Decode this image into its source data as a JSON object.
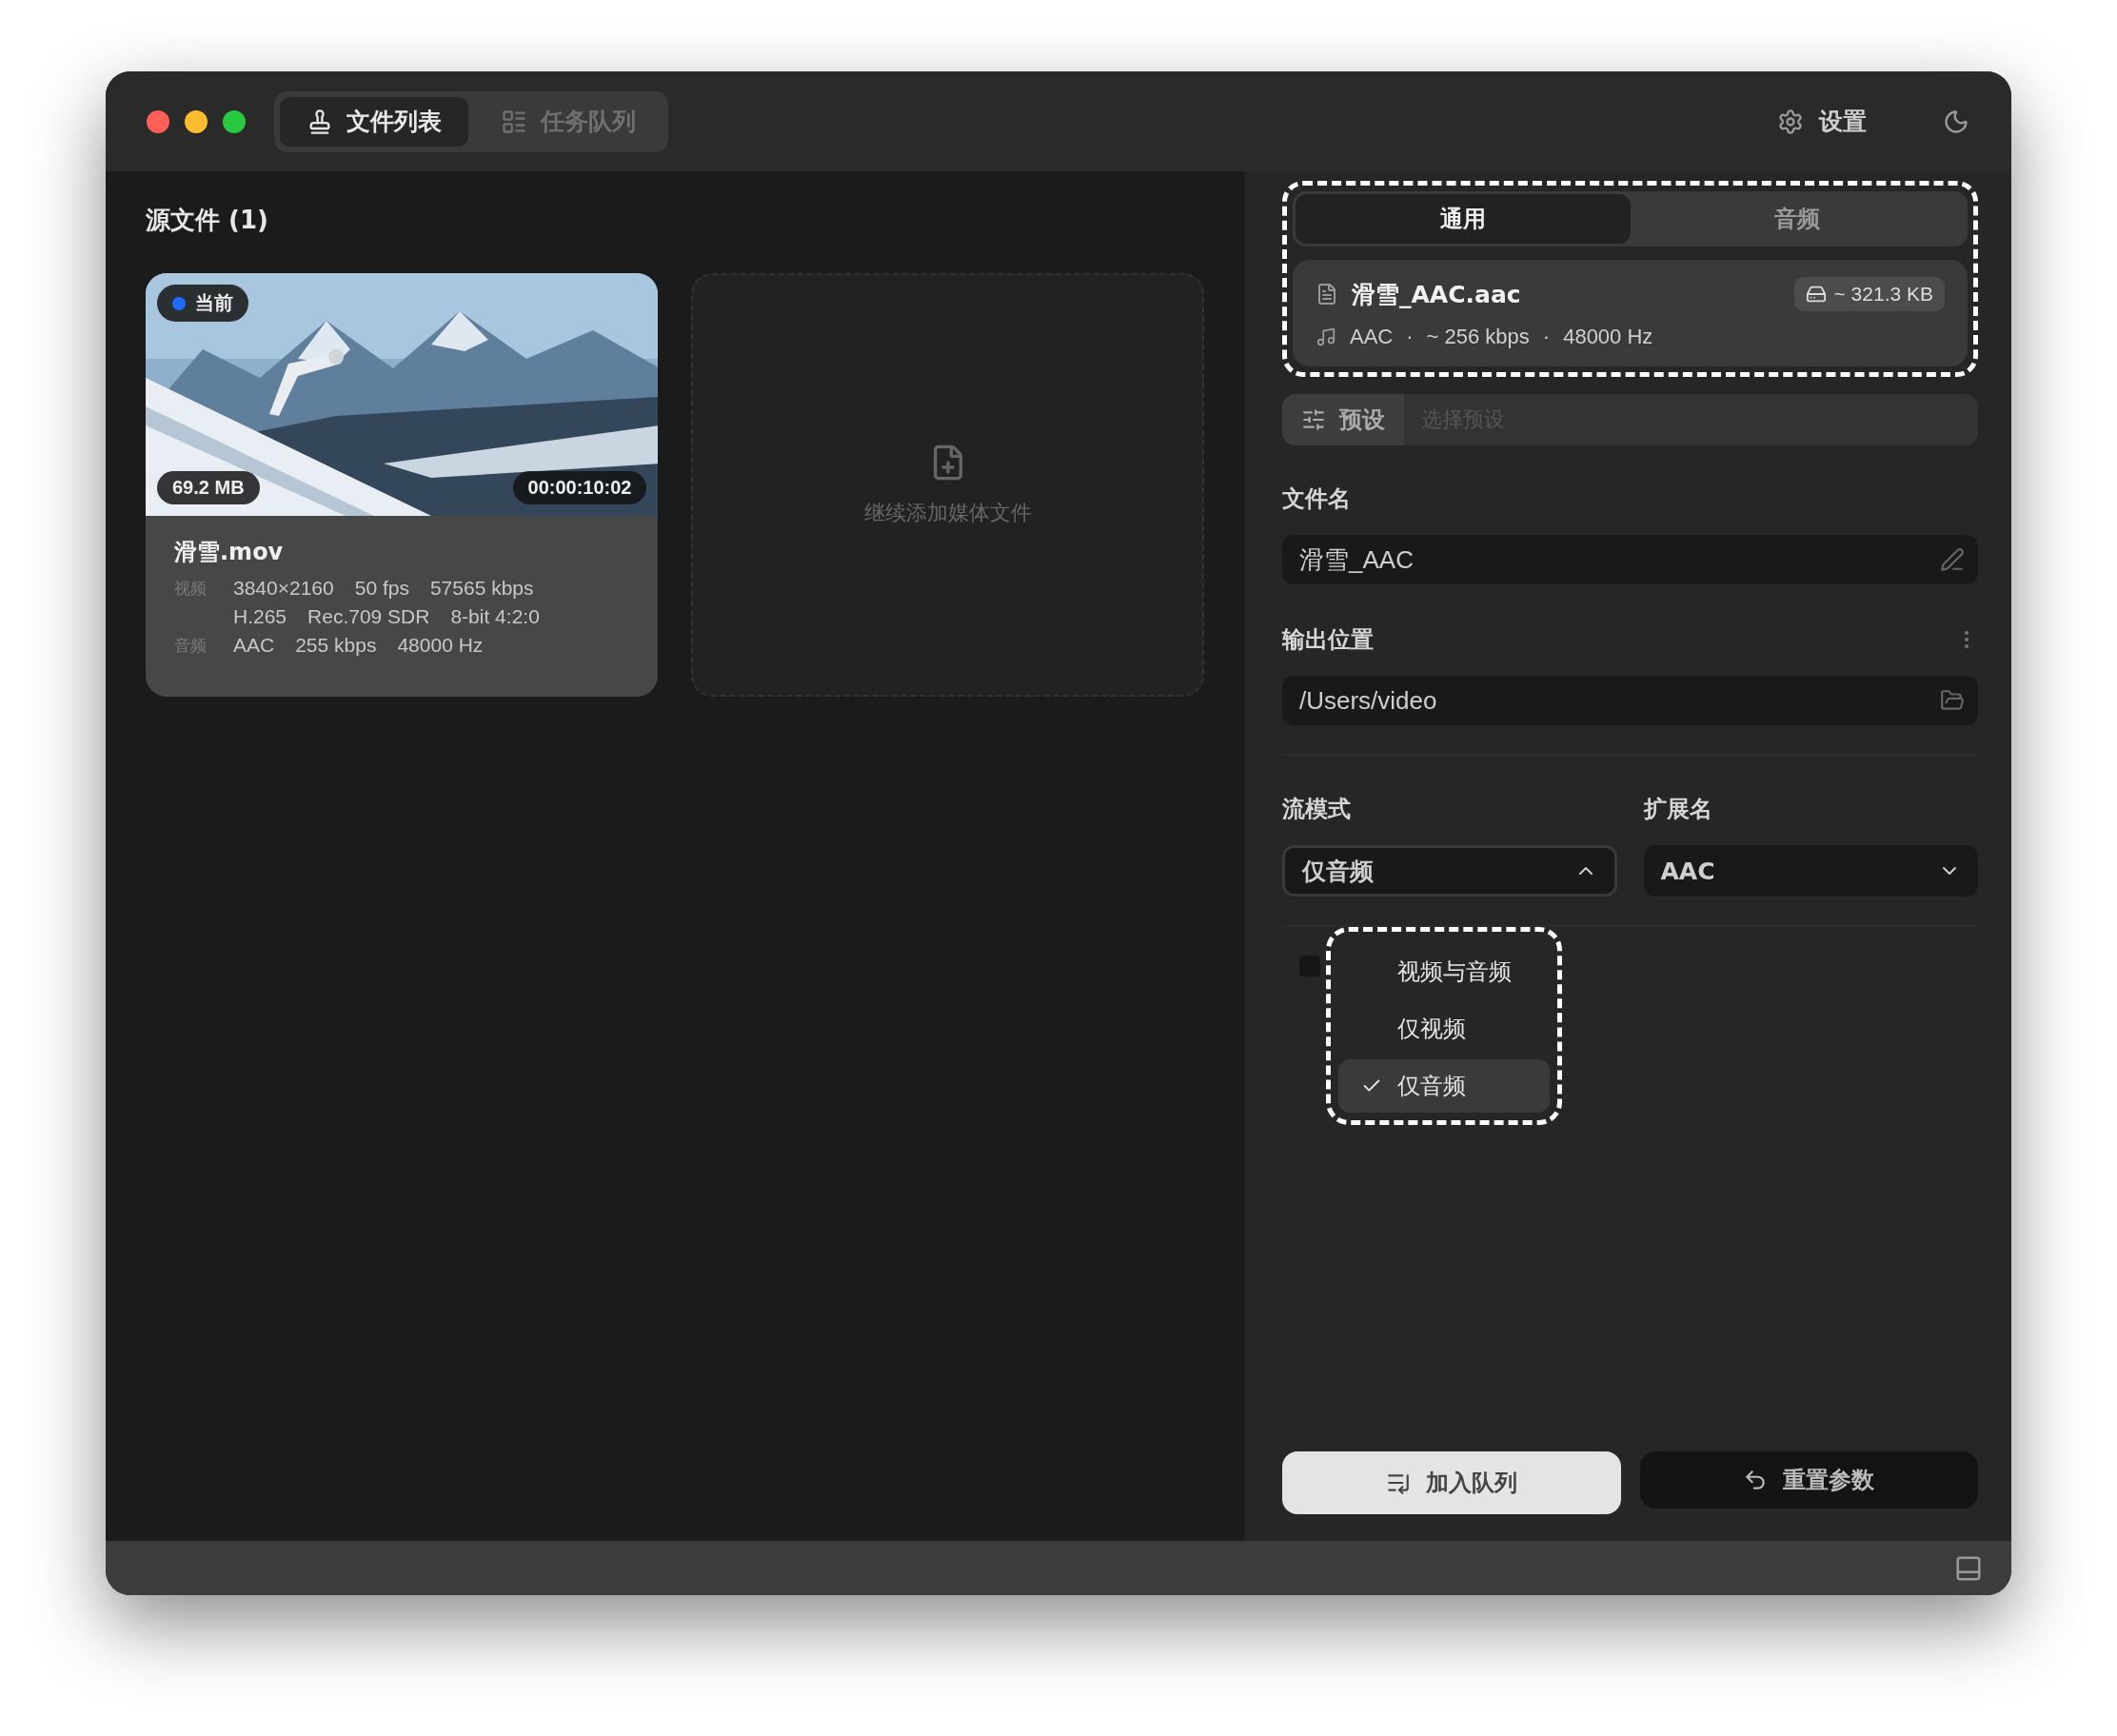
{
  "toolbar": {
    "tabs": [
      {
        "label": "文件列表",
        "selected": true
      },
      {
        "label": "任务队列",
        "selected": false
      }
    ],
    "settings": "设置"
  },
  "sources": {
    "title": "源文件 (1)",
    "files": [
      {
        "name": "滑雪.mov",
        "badge": "当前",
        "size": "69.2 MB",
        "duration": "00:00:10:02",
        "video_label": "视频",
        "video_lines": [
          [
            "3840×2160",
            "50 fps",
            "57565 kbps"
          ],
          [
            "H.265",
            "Rec.709 SDR",
            "8-bit 4:2:0"
          ]
        ],
        "audio_label": "音频",
        "audio": [
          "AAC",
          "255 kbps",
          "48000 Hz"
        ]
      }
    ],
    "add_more": "继续添加媒体文件"
  },
  "panel": {
    "tabs": [
      {
        "label": "通用",
        "selected": true
      },
      {
        "label": "音频",
        "selected": false
      }
    ],
    "output": {
      "filename": "滑雪_AAC.aac",
      "size": "~ 321.3 KB",
      "specs": [
        "AAC",
        "~ 256 kbps",
        "48000 Hz"
      ],
      "separator": "·"
    },
    "preset": {
      "label": "预设",
      "placeholder": "选择预设"
    },
    "filename": {
      "label": "文件名",
      "value": "滑雪_AAC"
    },
    "location": {
      "label": "输出位置",
      "value": "/Users/video"
    },
    "stream_mode": {
      "label": "流模式",
      "value": "仅音频",
      "expanded": true,
      "options": [
        {
          "label": "视频与音频",
          "selected": false
        },
        {
          "label": "仅视频",
          "selected": false
        },
        {
          "label": "仅音频",
          "selected": true
        }
      ]
    },
    "extension": {
      "label": "扩展名",
      "value": "AAC",
      "expanded": false
    },
    "checkbox": {
      "checked": false
    },
    "buttons": [
      {
        "label": "加入队列",
        "kind": "primary"
      },
      {
        "label": "重置参数",
        "kind": "secondary"
      }
    ]
  }
}
